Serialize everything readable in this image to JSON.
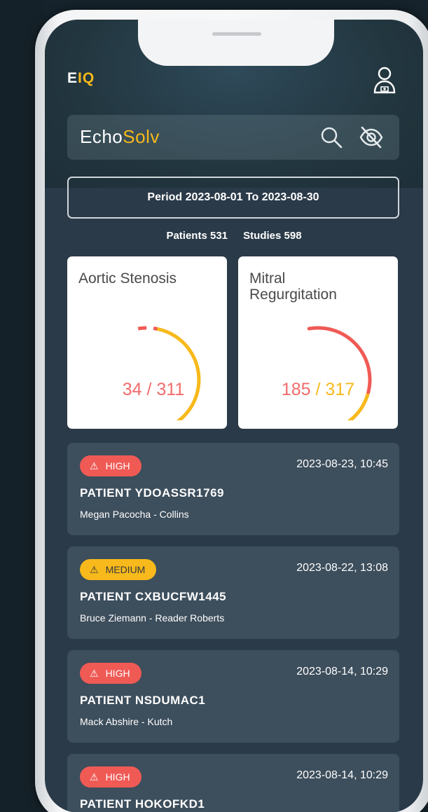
{
  "header": {
    "brand_e": "E",
    "brand_iq": "IQ",
    "logo_echo": "Echo",
    "logo_solv": "Solv"
  },
  "icons": {
    "user": "user-doctor-icon",
    "search": "search-icon",
    "visibility": "eye-off-icon",
    "warning": "warning-icon"
  },
  "period": {
    "label": "Period 2023-08-01 To 2023-08-30"
  },
  "stats": {
    "patients": "Patients 531",
    "studies": "Studies 598"
  },
  "cards": [
    {
      "title": "Aortic Stenosis",
      "current": "34",
      "separator": " / ",
      "total": "311",
      "progress": 0.109
    },
    {
      "title": "Mitral Regurgitation",
      "current": "185",
      "separator": " / ",
      "total": "317",
      "progress": 0.584
    }
  ],
  "alerts": [
    {
      "level": "HIGH",
      "date": "2023-08-23, 10:45",
      "patient": "PATIENT YDOASSR1769",
      "names": "Megan Pacocha - Collins"
    },
    {
      "level": "MEDIUM",
      "date": "2023-08-22, 13:08",
      "patient": "PATIENT CXBUCFW1445",
      "names": "Bruce Ziemann - Reader Roberts"
    },
    {
      "level": "HIGH",
      "date": "2023-08-14, 10:29",
      "patient": "PATIENT NSDUMAC1",
      "names": "Mack Abshire - Kutch"
    },
    {
      "level": "HIGH",
      "date": "2023-08-14, 10:29",
      "patient": "PATIENT HOKOFKD1",
      "names": ""
    }
  ],
  "colors": {
    "accent": "#f7b91b",
    "high": "#f05a55",
    "medium": "#f7b91b",
    "screen_bg": "#2b3a48",
    "alert_card": "#3d4e5c"
  }
}
